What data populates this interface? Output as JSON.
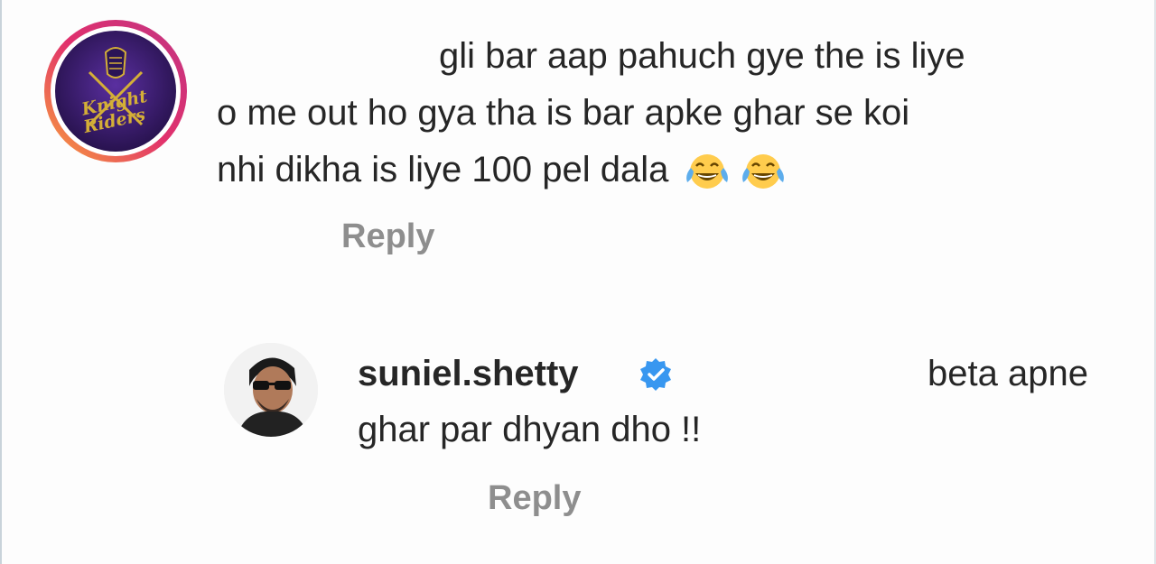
{
  "comment1": {
    "lines": [
      "gli bar aap pahuch gye the is liye",
      "o me out ho gya tha is bar apke ghar se koi",
      "nhi dikha is liye 100 pel dala"
    ],
    "emojis": [
      "face-with-tears-of-joy-icon",
      "face-with-tears-of-joy-icon"
    ],
    "reply_label": "Reply",
    "avatar_text": "Knight Riders"
  },
  "reply1": {
    "username": "suniel.shetty",
    "verified": true,
    "text_part1": "beta apne",
    "text_part2": "ghar par dhyan dho !!",
    "reply_label": "Reply"
  },
  "colors": {
    "text": "#262626",
    "muted": "#8e8e8e",
    "verified": "#3897f0",
    "kkr_purple": "#3a1f7a",
    "kkr_gold": "#d4af37"
  }
}
